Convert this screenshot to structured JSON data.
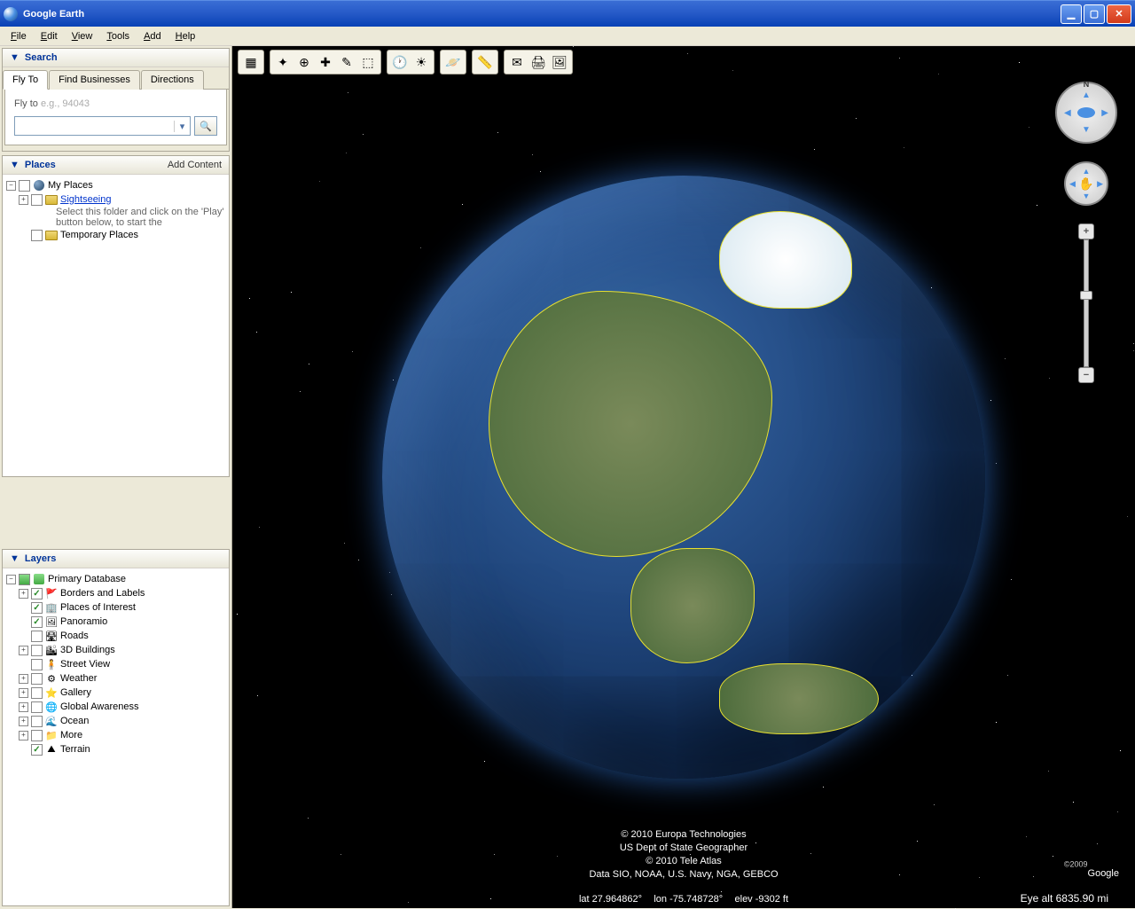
{
  "window": {
    "title": "Google Earth"
  },
  "menu": {
    "file": "File",
    "edit": "Edit",
    "view": "View",
    "tools": "Tools",
    "add": "Add",
    "help": "Help"
  },
  "search": {
    "title": "Search",
    "tabs": {
      "flyto": "Fly To",
      "find": "Find Businesses",
      "directions": "Directions"
    },
    "label": "Fly to",
    "placeholder": "e.g., 94043",
    "value": ""
  },
  "places": {
    "title": "Places",
    "add_content": "Add Content",
    "my_places": "My Places",
    "sightseeing": "Sightseeing",
    "hint": "Select this folder and click on the 'Play' button below, to start the",
    "temp": "Temporary Places"
  },
  "layers": {
    "title": "Layers",
    "primary": "Primary Database",
    "items": [
      {
        "label": "Borders and Labels",
        "checked": true,
        "expand": true,
        "icon": "🚩"
      },
      {
        "label": "Places of Interest",
        "checked": true,
        "expand": false,
        "icon": "🏢"
      },
      {
        "label": "Panoramio",
        "checked": true,
        "expand": false,
        "icon": "🖼"
      },
      {
        "label": "Roads",
        "checked": false,
        "expand": false,
        "icon": "🛣"
      },
      {
        "label": "3D Buildings",
        "checked": false,
        "expand": true,
        "icon": "🏙"
      },
      {
        "label": "Street View",
        "checked": false,
        "expand": false,
        "icon": "🧍"
      },
      {
        "label": "Weather",
        "checked": false,
        "expand": true,
        "icon": "⚙"
      },
      {
        "label": "Gallery",
        "checked": false,
        "expand": true,
        "icon": "⭐"
      },
      {
        "label": "Global Awareness",
        "checked": false,
        "expand": true,
        "icon": "🌐"
      },
      {
        "label": "Ocean",
        "checked": false,
        "expand": true,
        "icon": "🌊"
      },
      {
        "label": "More",
        "checked": false,
        "expand": true,
        "icon": "📁"
      },
      {
        "label": "Terrain",
        "checked": true,
        "expand": false,
        "icon": "⛰"
      }
    ]
  },
  "attribution": {
    "line1": "© 2010 Europa Technologies",
    "line2": "US Dept of State Geographer",
    "line3": "© 2010 Tele Atlas",
    "line4": "Data SIO, NOAA, U.S. Navy, NGA, GEBCO"
  },
  "status": {
    "lat": "lat  27.964862°",
    "lon": "lon  -75.748728°",
    "elev": "elev -9302 ft",
    "eye": "Eye alt  6835.90 mi"
  },
  "logo": {
    "copyright": "©2009",
    "text": "Google"
  },
  "toolbar_icons": [
    "▦",
    "✦",
    "⊕",
    "✚",
    "✎",
    "⬚",
    "⏰",
    "🌅",
    "🪐",
    "📏",
    "✉",
    "🖨",
    "🖼"
  ]
}
